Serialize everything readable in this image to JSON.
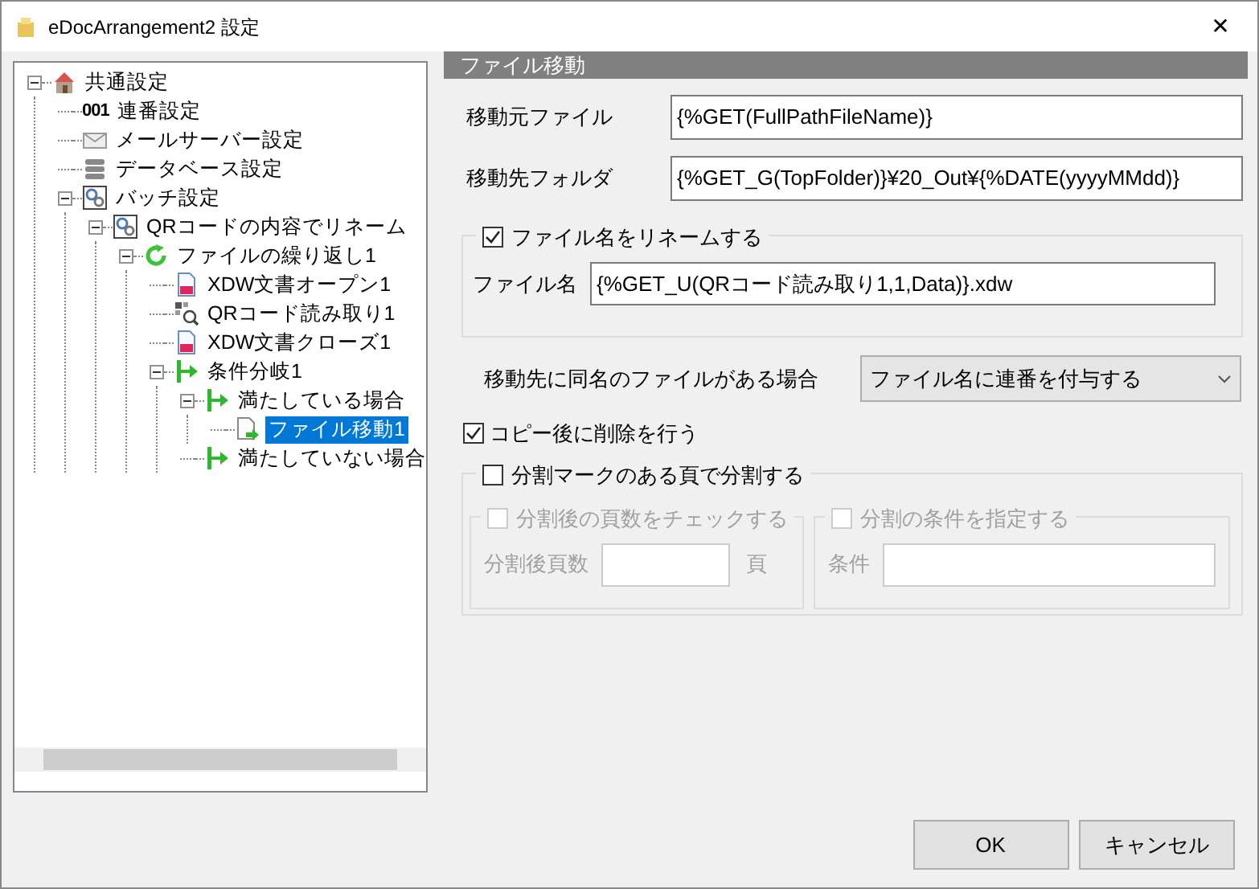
{
  "window": {
    "title": "eDocArrangement2 設定",
    "close": "✕"
  },
  "tree": [
    {
      "label": "共通設定",
      "kind": "house",
      "expanded": true,
      "selected": false,
      "children": [
        {
          "label": "連番設定",
          "kind": "number",
          "icon_text": "001",
          "selected": false
        },
        {
          "label": "メールサーバー設定",
          "kind": "mail",
          "selected": false
        },
        {
          "label": "データベース設定",
          "kind": "database",
          "selected": false
        },
        {
          "label": "バッチ設定",
          "kind": "gearbox",
          "expanded": true,
          "selected": false,
          "children": [
            {
              "label": "QRコードの内容でリネーム",
              "kind": "gearbox",
              "expanded": true,
              "selected": false,
              "children": [
                {
                  "label": "ファイルの繰り返し1",
                  "kind": "loop",
                  "expanded": true,
                  "selected": false,
                  "children": [
                    {
                      "label": "XDW文書オープン1",
                      "kind": "document",
                      "selected": false
                    },
                    {
                      "label": "QRコード読み取り1",
                      "kind": "qrsearch",
                      "selected": false
                    },
                    {
                      "label": "XDW文書クローズ1",
                      "kind": "document",
                      "selected": false
                    },
                    {
                      "label": "条件分岐1",
                      "kind": "branch",
                      "expanded": true,
                      "selected": false,
                      "children": [
                        {
                          "label": "満たしている場合",
                          "kind": "branch",
                          "expanded": true,
                          "selected": false,
                          "children": [
                            {
                              "label": "ファイル移動1",
                              "kind": "filemove",
                              "selected": true
                            }
                          ]
                        },
                        {
                          "label": "満たしていない場合",
                          "kind": "branch",
                          "selected": false
                        }
                      ]
                    }
                  ]
                }
              ]
            }
          ]
        }
      ]
    }
  ],
  "panel": {
    "header": "ファイル移動",
    "source": {
      "label": "移動元ファイル",
      "value": "{%GET(FullPathFileName)}"
    },
    "dest": {
      "label": "移動先フォルダ",
      "value": "{%GET_G(TopFolder)}¥20_Out¥{%DATE(yyyyMMdd)}"
    },
    "rename": {
      "label": "ファイル名をリネームする",
      "checked": true,
      "field_label": "ファイル名",
      "value": "{%GET_U(QRコード読み取り1,1,Data)}.xdw"
    },
    "conflict": {
      "label": "移動先に同名のファイルがある場合",
      "value": "ファイル名に連番を付与する"
    },
    "delete_after_copy": {
      "label": "コピー後に削除を行う",
      "checked": true
    },
    "split": {
      "label": "分割マークのある頁で分割する",
      "checked": false,
      "page_check": {
        "label": "分割後の頁数をチェックする",
        "checked": false,
        "disabled": true,
        "field_label": "分割後頁数",
        "unit": "頁"
      },
      "condition": {
        "label": "分割の条件を指定する",
        "checked": false,
        "disabled": true,
        "field_label": "条件"
      }
    }
  },
  "buttons": [
    {
      "label": "OK"
    },
    {
      "label": "キャンセル"
    }
  ]
}
